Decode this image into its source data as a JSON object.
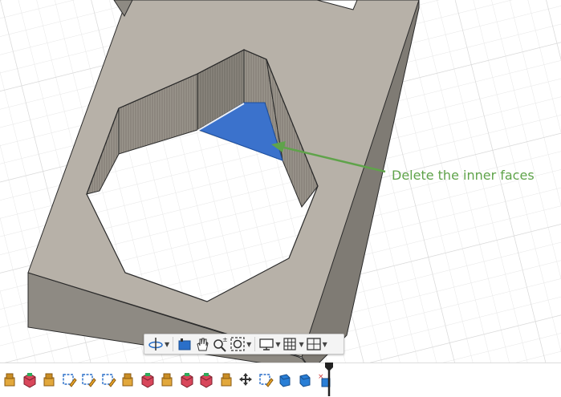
{
  "annotation": {
    "text": "Delete the inner faces",
    "color": "#5fa34a"
  },
  "colors": {
    "model_face": "#b7b1a8",
    "model_side": "#7e7a73",
    "selected_face": "#3b72cc",
    "grid_line": "#e4e4e4"
  },
  "navigation_toolbar": {
    "tools": [
      {
        "icon": "orbit-icon",
        "has_dropdown": true
      },
      {
        "icon": "look-at-icon",
        "has_dropdown": false
      },
      {
        "icon": "pan-hand-icon",
        "has_dropdown": false
      },
      {
        "icon": "zoom-icon",
        "has_dropdown": false
      },
      {
        "icon": "fit-icon",
        "has_dropdown": true
      },
      {
        "icon": "display-settings-icon",
        "has_dropdown": true
      },
      {
        "icon": "grid-icon",
        "has_dropdown": true
      },
      {
        "icon": "viewports-icon",
        "has_dropdown": true
      }
    ]
  },
  "timeline": {
    "items": [
      "extrude-icon",
      "sphere-body-icon",
      "extrude-icon",
      "sketch-icon",
      "sketch-icon",
      "sketch-icon",
      "extrude-icon",
      "sphere-body-icon",
      "extrude-icon",
      "sphere-body-icon",
      "sphere-body-icon",
      "extrude-icon",
      "move-icon",
      "sketch-icon",
      "surface-icon",
      "surface-icon",
      "delete-face-icon"
    ]
  }
}
